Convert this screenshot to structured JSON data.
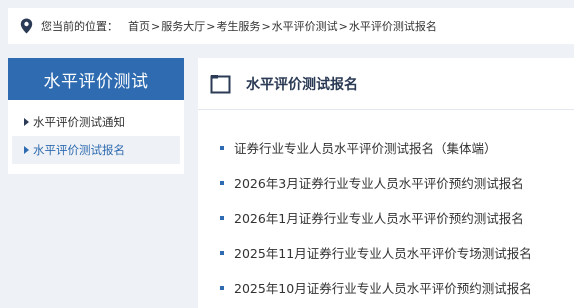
{
  "breadcrumb": {
    "prefix": "您当前的位置：",
    "items": [
      "首页",
      "服务大厅",
      "考生服务",
      "水平评价测试",
      "水平评价测试报名"
    ],
    "separator": ">"
  },
  "sidebar": {
    "title": "水平评价测试",
    "items": [
      {
        "label": "水平评价测试通知"
      },
      {
        "label": "水平评价测试报名"
      }
    ]
  },
  "main": {
    "title": "水平评价测试报名",
    "list": [
      {
        "label": "证券行业专业人员水平评价测试报名（集体端）"
      },
      {
        "label": "2026年3月证券行业专业人员水平评价预约测试报名"
      },
      {
        "label": "2026年1月证券行业专业人员水平评价预约测试报名"
      },
      {
        "label": "2025年11月证券行业专业人员水平评价专场测试报名"
      },
      {
        "label": "2025年10月证券行业专业人员水平评价预约测试报名"
      }
    ]
  },
  "colors": {
    "accent": "#2e6bb0",
    "page_bg": "#eef1f6",
    "nav_dark": "#2b3a55"
  },
  "icons": {
    "location": "map-pin-icon",
    "header": "frame-icon"
  }
}
